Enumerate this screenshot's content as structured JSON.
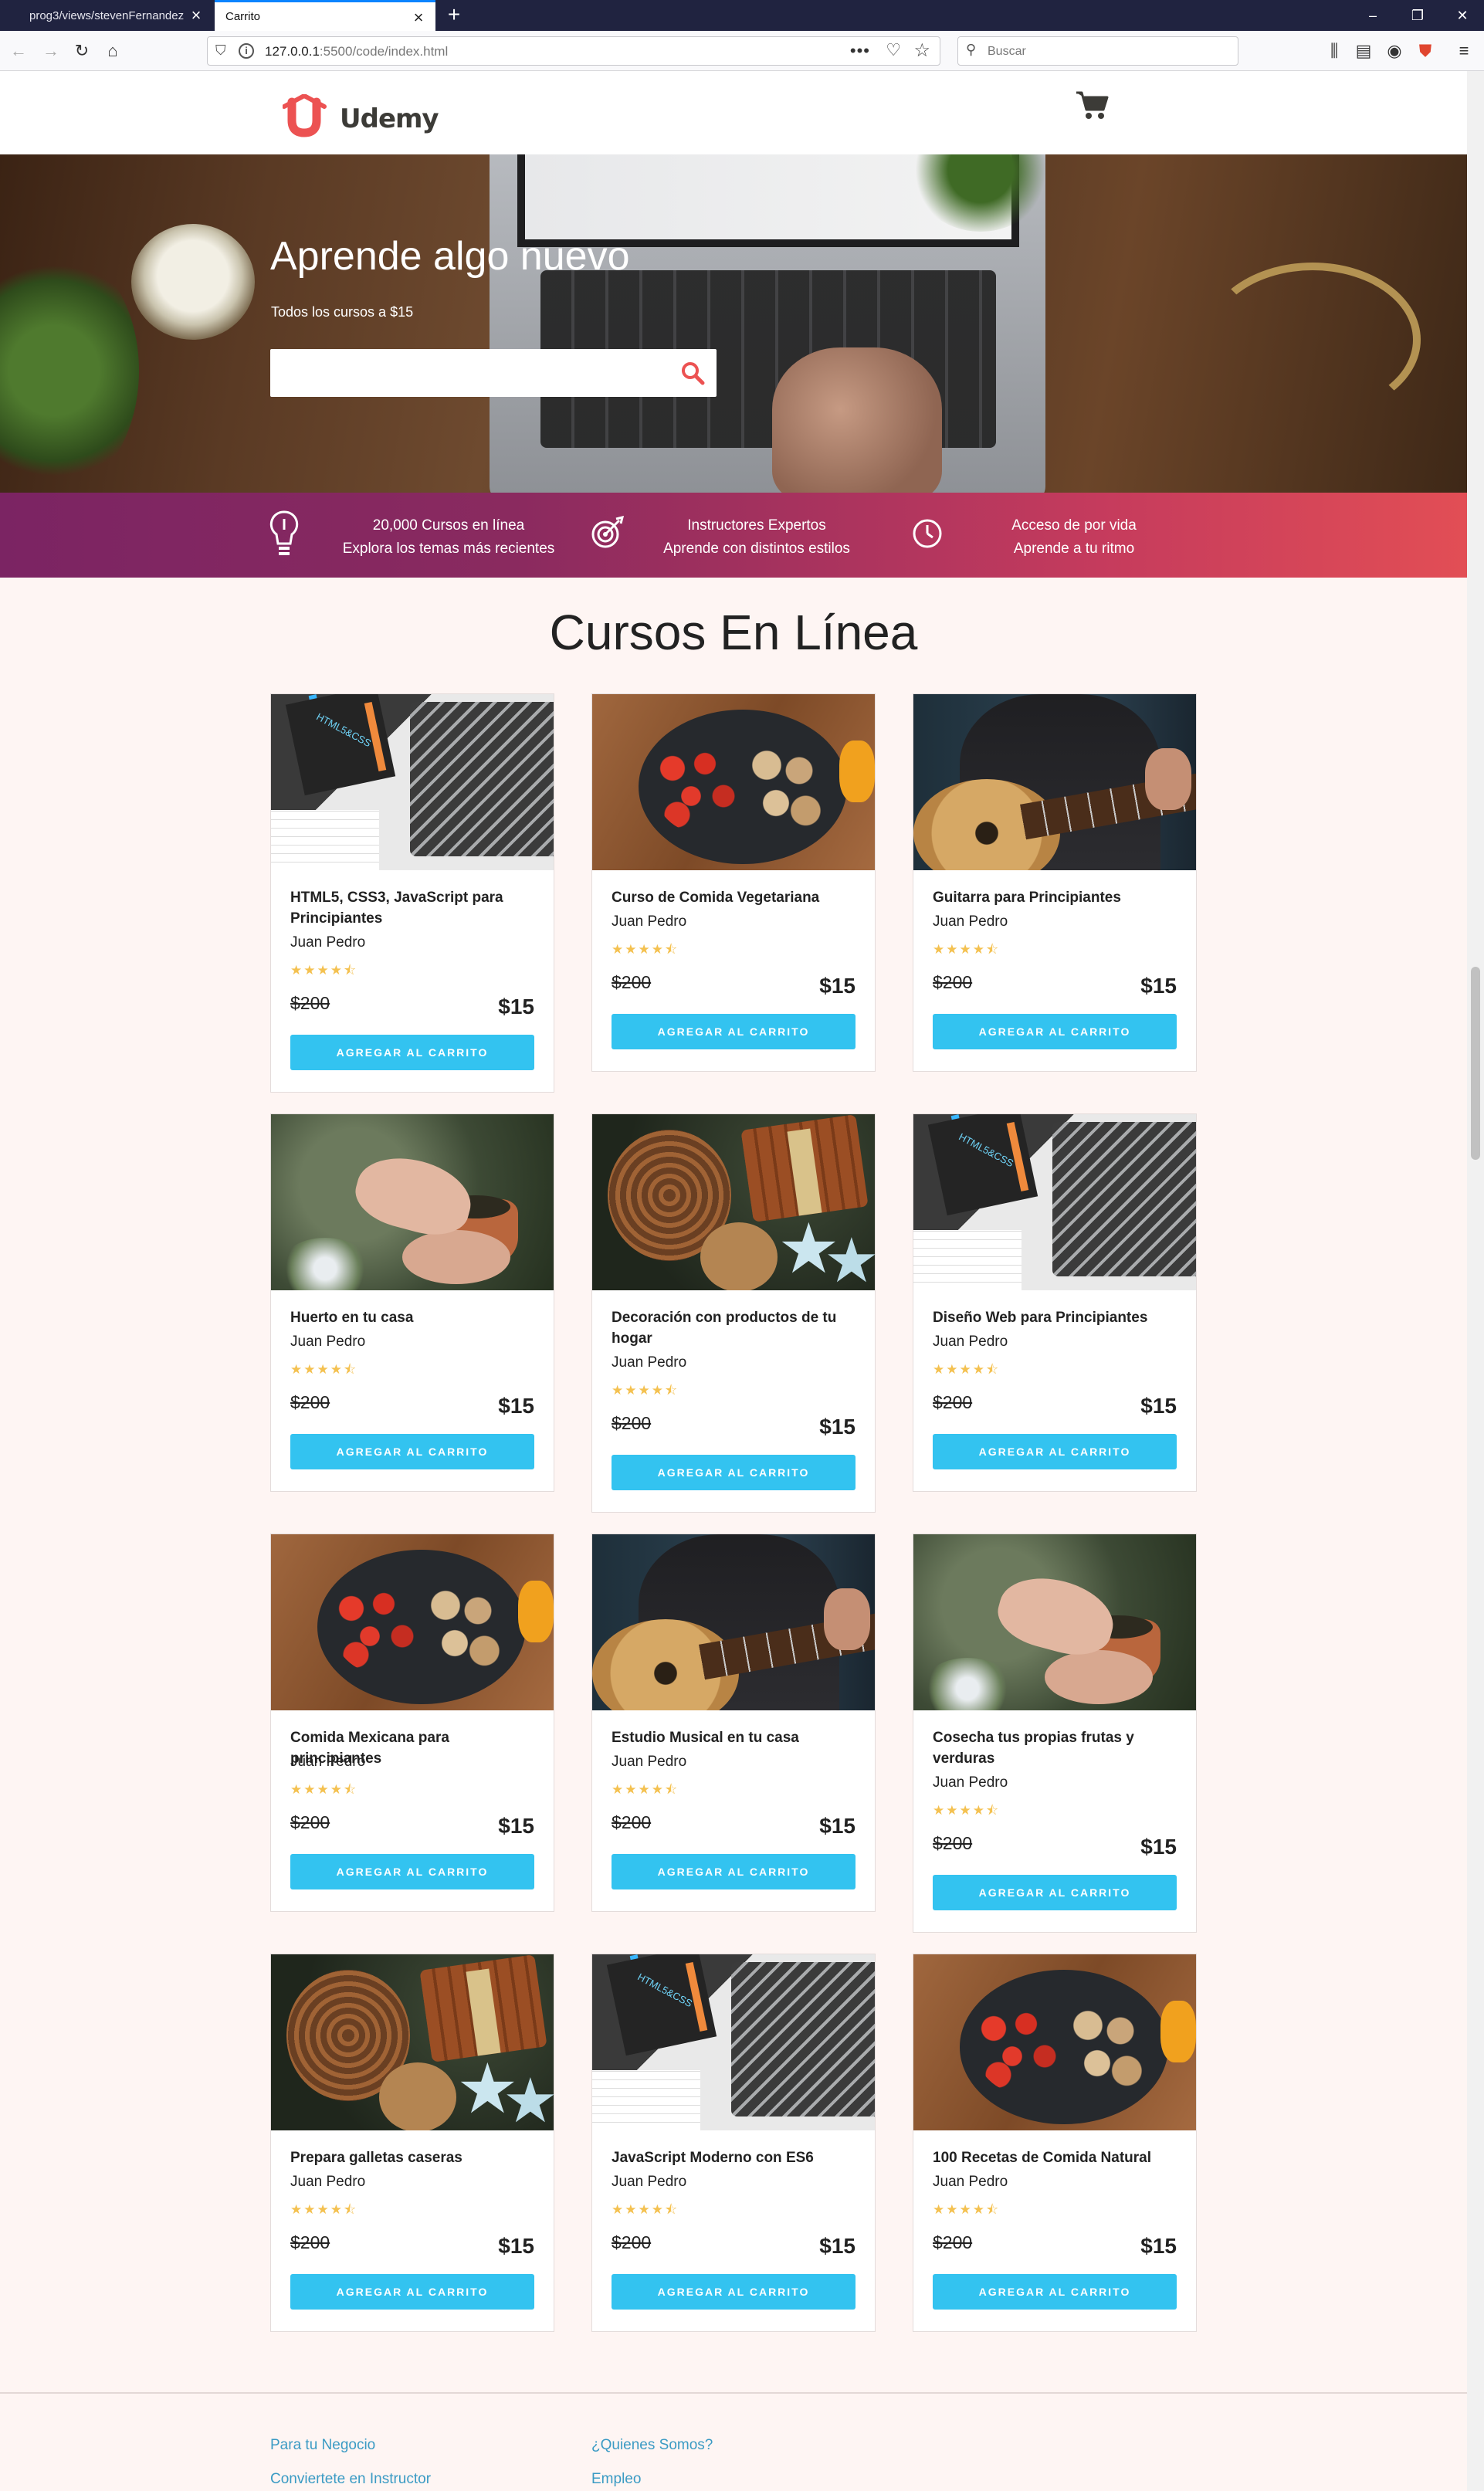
{
  "browser": {
    "tabs": [
      {
        "label": "prog3/views/stevenFernandez"
      },
      {
        "label": "Carrito"
      }
    ],
    "url_host": "127.0.0.1",
    "url_rest": ":5500/code/index.html",
    "search_placeholder": "Buscar"
  },
  "site": {
    "logo_text": "Udemy",
    "brand_color": "#ec5252",
    "accent_color": "#33c3f0"
  },
  "hero": {
    "title": "Aprende algo nuevo",
    "subtitle": "Todos los cursos a $15",
    "search_value": ""
  },
  "features": [
    {
      "icon": "lightbulb-icon",
      "line1": "20,000 Cursos en línea",
      "line2": "Explora los temas más recientes"
    },
    {
      "icon": "target-icon",
      "line1": "Instructores Expertos",
      "line2": "Aprende con distintos estilos"
    },
    {
      "icon": "clock-icon",
      "line1": "Acceso de por vida",
      "line2": "Aprende a tu ritmo"
    }
  ],
  "courses": {
    "title": "Cursos En Línea",
    "add_label": "AGREGAR AL CARRITO",
    "stars": "★★★★⯪",
    "items": [
      {
        "title": "HTML5, CSS3, JavaScript para Principiantes",
        "author": "Juan Pedro",
        "old_price": "$200",
        "price": "$15",
        "image": "html-book"
      },
      {
        "title": "Curso de Comida Vegetariana",
        "author": "Juan Pedro",
        "old_price": "$200",
        "price": "$15",
        "image": "food-pan"
      },
      {
        "title": "Guitarra para Principiantes",
        "author": "Juan Pedro",
        "old_price": "$200",
        "price": "$15",
        "image": "guitar"
      },
      {
        "title": "Huerto en tu casa",
        "author": "Juan Pedro",
        "old_price": "$200",
        "price": "$15",
        "image": "garden-pot"
      },
      {
        "title": "Decoración con productos de tu hogar",
        "author": "Juan Pedro",
        "old_price": "$200",
        "price": "$15",
        "image": "pinecone"
      },
      {
        "title": "Diseño Web para Principiantes",
        "author": "Juan Pedro",
        "old_price": "$200",
        "price": "$15",
        "image": "html-book"
      },
      {
        "title": "Comida Mexicana para principiantes",
        "author": "Juan Pedro",
        "old_price": "$200",
        "price": "$15",
        "image": "food-pan"
      },
      {
        "title": "Estudio Musical en tu casa",
        "author": "Juan Pedro",
        "old_price": "$200",
        "price": "$15",
        "image": "guitar"
      },
      {
        "title": "Cosecha tus propias frutas y verduras",
        "author": "Juan Pedro",
        "old_price": "$200",
        "price": "$15",
        "image": "garden-pot"
      },
      {
        "title": "Prepara galletas caseras",
        "author": "Juan Pedro",
        "old_price": "$200",
        "price": "$15",
        "image": "pinecone"
      },
      {
        "title": "JavaScript Moderno con ES6",
        "author": "Juan Pedro",
        "old_price": "$200",
        "price": "$15",
        "image": "html-book"
      },
      {
        "title": "100 Recetas de Comida Natural",
        "author": "Juan Pedro",
        "old_price": "$200",
        "price": "$15",
        "image": "food-pan"
      }
    ]
  },
  "footer": {
    "col1": [
      "Para tu Negocio",
      "Conviertete en Instructor"
    ],
    "col2": [
      "¿Quienes Somos?",
      "Empleo"
    ]
  }
}
